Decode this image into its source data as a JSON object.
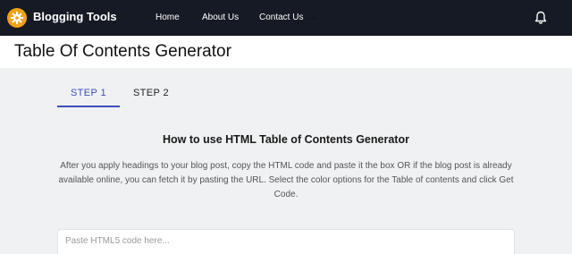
{
  "header": {
    "brand": "Blogging Tools",
    "logo_icon": "gear-icon",
    "nav": [
      {
        "label": "Home"
      },
      {
        "label": "About Us"
      },
      {
        "label": "Contact Us"
      }
    ],
    "nav_arrow": "→",
    "notification_icon": "bell-icon"
  },
  "page": {
    "title": "Table Of Contents Generator"
  },
  "tabs": [
    {
      "label": "STEP 1",
      "active": true
    },
    {
      "label": "STEP 2",
      "active": false
    }
  ],
  "content": {
    "heading": "How to use HTML Table of Contents Generator",
    "intro": "After you apply headings to your blog post, copy the HTML code and paste it the box OR if the blog post is already available online, you can fetch it by pasting the URL. Select the color options for the Table of contents and click Get Code.",
    "input_placeholder": "Paste HTML5 code here..."
  },
  "colors": {
    "header_bg": "#151a24",
    "accent": "#3b4fb8",
    "logo": "#f0a315"
  }
}
